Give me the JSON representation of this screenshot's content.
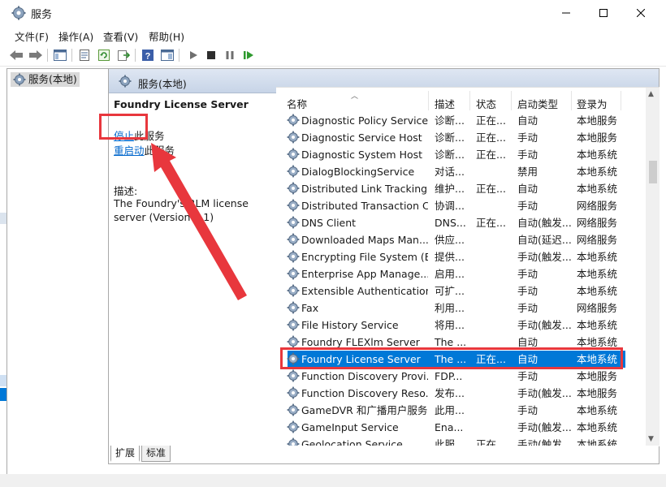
{
  "window": {
    "title": "服务"
  },
  "menu": {
    "items": [
      "文件(F)",
      "操作(A)",
      "查看(V)",
      "帮助(H)"
    ]
  },
  "tree": {
    "item_label": "服务(本地)"
  },
  "content": {
    "header_title": "服务(本地)",
    "detail": {
      "service_name": "Foundry License Server",
      "stop_link": "停止",
      "stop_suffix": "此服务",
      "restart_link": "重启动",
      "restart_suffix": "此服务",
      "description_label": "描述:",
      "description_text": "The Foundry's RLM license server (Version 7.1)"
    },
    "columns": [
      "名称",
      "描述",
      "状态",
      "启动类型",
      "登录为"
    ],
    "rows": [
      {
        "name": "Diagnostic Policy Service",
        "desc": "诊断...",
        "status": "正在...",
        "startup": "自动",
        "logon": "本地服务"
      },
      {
        "name": "Diagnostic Service Host",
        "desc": "诊断...",
        "status": "正在...",
        "startup": "手动",
        "logon": "本地服务"
      },
      {
        "name": "Diagnostic System Host",
        "desc": "诊断...",
        "status": "正在...",
        "startup": "手动",
        "logon": "本地系统"
      },
      {
        "name": "DialogBlockingService",
        "desc": "对话...",
        "status": "",
        "startup": "禁用",
        "logon": "本地系统"
      },
      {
        "name": "Distributed Link Tracking...",
        "desc": "维护...",
        "status": "正在...",
        "startup": "自动",
        "logon": "本地系统"
      },
      {
        "name": "Distributed Transaction C...",
        "desc": "协调...",
        "status": "",
        "startup": "手动",
        "logon": "网络服务"
      },
      {
        "name": "DNS Client",
        "desc": "DNS...",
        "status": "正在...",
        "startup": "自动(触发...",
        "logon": "网络服务"
      },
      {
        "name": "Downloaded Maps Man...",
        "desc": "供应...",
        "status": "",
        "startup": "自动(延迟...",
        "logon": "网络服务"
      },
      {
        "name": "Encrypting File System (E...",
        "desc": "提供...",
        "status": "",
        "startup": "手动(触发...",
        "logon": "本地系统"
      },
      {
        "name": "Enterprise App Manage...",
        "desc": "启用...",
        "status": "",
        "startup": "手动",
        "logon": "本地系统"
      },
      {
        "name": "Extensible Authentication...",
        "desc": "可扩...",
        "status": "",
        "startup": "手动",
        "logon": "本地系统"
      },
      {
        "name": "Fax",
        "desc": "利用...",
        "status": "",
        "startup": "手动",
        "logon": "网络服务"
      },
      {
        "name": "File History Service",
        "desc": "将用...",
        "status": "",
        "startup": "手动(触发...",
        "logon": "本地系统"
      },
      {
        "name": "Foundry FLEXlm Server",
        "desc": "The ...",
        "status": "",
        "startup": "自动",
        "logon": "本地系统"
      },
      {
        "name": "Foundry License Server",
        "desc": "The ...",
        "status": "正在...",
        "startup": "自动",
        "logon": "本地系统"
      },
      {
        "name": "Function Discovery Provi...",
        "desc": "FDP...",
        "status": "",
        "startup": "手动",
        "logon": "本地服务"
      },
      {
        "name": "Function Discovery Reso...",
        "desc": "发布...",
        "status": "",
        "startup": "手动(触发...",
        "logon": "本地服务"
      },
      {
        "name": "GameDVR 和广播用户服务...",
        "desc": "此用...",
        "status": "",
        "startup": "手动",
        "logon": "本地系统"
      },
      {
        "name": "GameInput Service",
        "desc": "Ena...",
        "status": "",
        "startup": "手动(触发...",
        "logon": "本地系统"
      },
      {
        "name": "Geolocation Service",
        "desc": "此服...",
        "status": "正在...",
        "startup": "手动(触发...",
        "logon": "本地系统"
      }
    ],
    "selected_index": 14
  },
  "tabs": [
    "扩展",
    "标准"
  ],
  "colors": {
    "selection": "#0078d7",
    "annotation": "#e8373d",
    "link": "#0066cc"
  }
}
